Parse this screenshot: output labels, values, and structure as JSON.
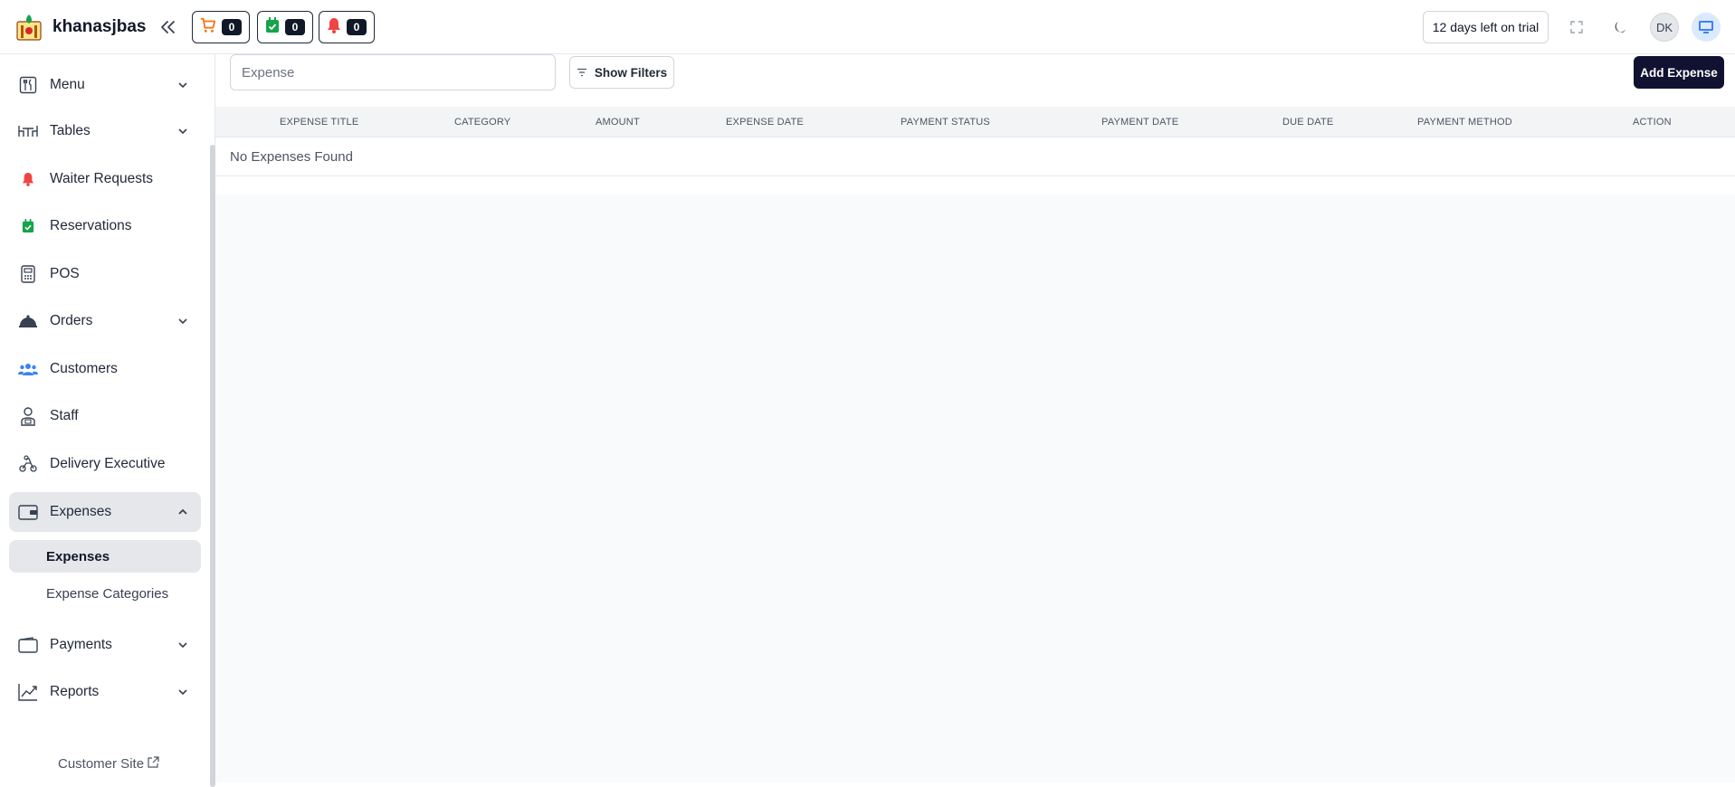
{
  "brand": {
    "name": "khanasjbas"
  },
  "header": {
    "counters": [
      {
        "icon": "cart-icon",
        "count": "0",
        "color": "#f97316"
      },
      {
        "icon": "calendar-check-icon",
        "count": "0",
        "color": "#16a34a"
      },
      {
        "icon": "bell-icon",
        "count": "0",
        "color": "#ef4444"
      }
    ],
    "trial_label": "12 days left on trial",
    "avatar_initials": "DK"
  },
  "sidebar": {
    "items": [
      {
        "label": "Menu",
        "icon": "utensils-icon"
      },
      {
        "label": "Tables",
        "icon": "table-icon"
      },
      {
        "label": "Waiter Requests",
        "icon": "bell-icon"
      },
      {
        "label": "Reservations",
        "icon": "calendar-check-icon"
      },
      {
        "label": "POS",
        "icon": "pos-terminal-icon"
      },
      {
        "label": "Orders",
        "icon": "cloche-icon"
      },
      {
        "label": "Customers",
        "icon": "users-icon"
      },
      {
        "label": "Staff",
        "icon": "staff-icon"
      },
      {
        "label": "Delivery Executive",
        "icon": "delivery-scooter-icon"
      },
      {
        "label": "Expenses",
        "icon": "wallet-icon"
      },
      {
        "label": "Payments",
        "icon": "wallet-outline-icon"
      },
      {
        "label": "Reports",
        "icon": "chart-line-icon"
      }
    ],
    "expenses_sub": [
      "Expenses",
      "Expense Categories"
    ],
    "customer_site": "Customer Site"
  },
  "main": {
    "search_placeholder": "Expense",
    "show_filters": "Show Filters",
    "add_expense": "Add Expense",
    "columns": [
      "EXPENSE TITLE",
      "CATEGORY",
      "AMOUNT",
      "EXPENSE DATE",
      "PAYMENT STATUS",
      "PAYMENT DATE",
      "DUE DATE",
      "PAYMENT METHOD",
      "ACTION"
    ],
    "empty_message": "No Expenses Found"
  },
  "colors": {
    "accent": "#111132",
    "active_bg": "#e5e7eb",
    "page_bg": "#f9fafb"
  }
}
